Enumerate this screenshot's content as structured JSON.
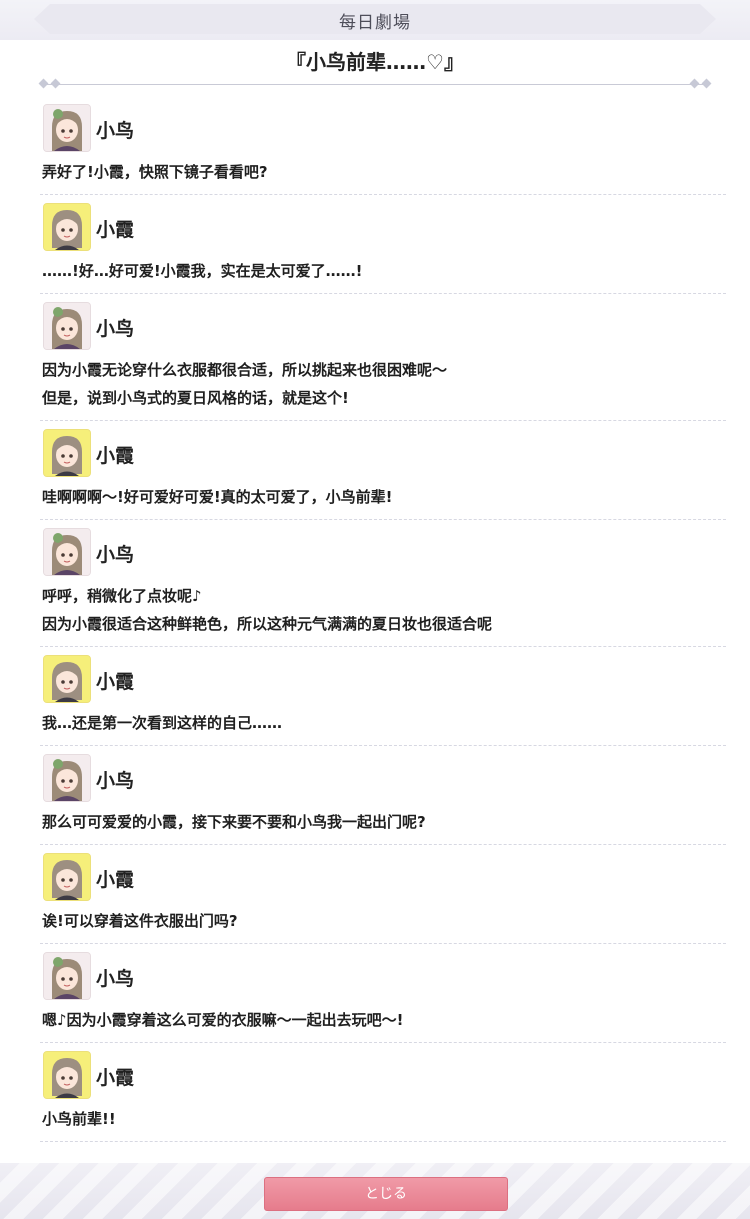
{
  "header": {
    "title": "每日劇場"
  },
  "story": {
    "title": "『小鸟前辈……♡』"
  },
  "speakers": {
    "kotori": "小鸟",
    "kasumi": "小霞"
  },
  "dialogue": [
    {
      "speaker": "小鸟",
      "avatar": "kotori-avatar",
      "lines": [
        "弄好了!小霞，快照下镜子看看吧?"
      ]
    },
    {
      "speaker": "小霞",
      "avatar": "kasumi-avatar",
      "lines": [
        "……!好…好可爱!小霞我，实在是太可爱了……!"
      ]
    },
    {
      "speaker": "小鸟",
      "avatar": "kotori-avatar",
      "lines": [
        "因为小霞无论穿什么衣服都很合适，所以挑起来也很困难呢～",
        "但是，说到小鸟式的夏日风格的话，就是这个!"
      ]
    },
    {
      "speaker": "小霞",
      "avatar": "kasumi-avatar",
      "lines": [
        "哇啊啊啊～!好可爱好可爱!真的太可爱了，小鸟前辈!"
      ]
    },
    {
      "speaker": "小鸟",
      "avatar": "kotori-avatar",
      "lines": [
        "呼呼，稍微化了点妆呢♪",
        "因为小霞很适合这种鲜艳色，所以这种元气满满的夏日妆也很适合呢"
      ]
    },
    {
      "speaker": "小霞",
      "avatar": "kasumi-avatar",
      "lines": [
        "我…还是第一次看到这样的自己……"
      ]
    },
    {
      "speaker": "小鸟",
      "avatar": "kotori-avatar",
      "lines": [
        "那么可可爱爱的小霞，接下来要不要和小鸟我一起出门呢?"
      ]
    },
    {
      "speaker": "小霞",
      "avatar": "kasumi-avatar",
      "lines": [
        "诶!可以穿着这件衣服出门吗?"
      ]
    },
    {
      "speaker": "小鸟",
      "avatar": "kotori-avatar",
      "lines": [
        "嗯♪因为小霞穿着这么可爱的衣服嘛～一起出去玩吧～!"
      ]
    },
    {
      "speaker": "小霞",
      "avatar": "kasumi-avatar",
      "lines": [
        "小鸟前辈!!"
      ]
    }
  ],
  "footer": {
    "close_label": "とじる"
  },
  "colors": {
    "close_button": "#e88392",
    "kasumi_avatar_bg": "#f6ef7a",
    "kotori_avatar_bg": "#f4ecee"
  }
}
